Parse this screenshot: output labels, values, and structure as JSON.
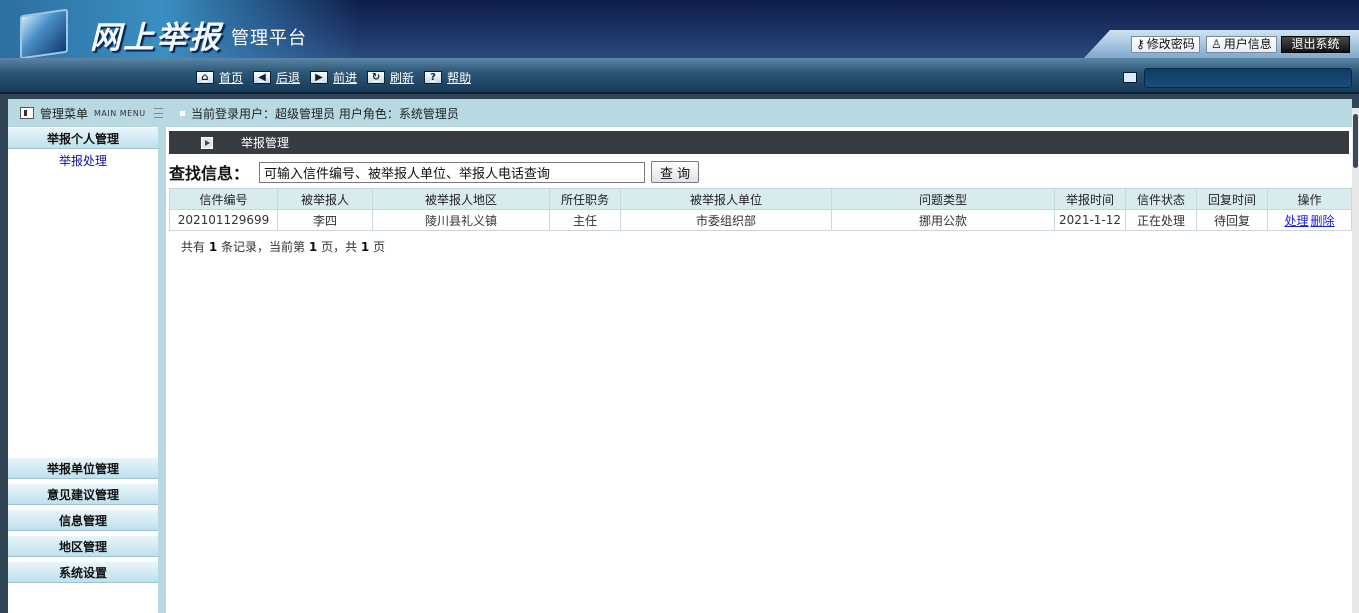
{
  "header": {
    "brand_main": "网上举报",
    "brand_sub": "管理平台",
    "buttons": {
      "change_password": "修改密码",
      "user_info": "用户信息",
      "logout": "退出系统"
    }
  },
  "nav": {
    "items": [
      {
        "label": "首页",
        "icon": "home-icon"
      },
      {
        "label": "后退",
        "icon": "back-arrow-icon"
      },
      {
        "label": "前进",
        "icon": "forward-arrow-icon"
      },
      {
        "label": "刷新",
        "icon": "refresh-icon"
      },
      {
        "label": "帮助",
        "icon": "help-icon"
      }
    ]
  },
  "strip": {
    "menu_title": "管理菜单",
    "menu_sub": "MAIN MENU",
    "user_line": "当前登录用户：超级管理员  用户角色：系统管理员"
  },
  "sidebar": {
    "top_group": "举报个人管理",
    "top_sub": "举报处理",
    "groups": [
      "举报单位管理",
      "意见建议管理",
      "信息管理",
      "地区管理",
      "系统设置"
    ]
  },
  "content": {
    "title": "举报管理",
    "search_label": "查找信息：",
    "search_value": "可输入信件编号、被举报人单位、举报人电话查询",
    "search_button": "查 询",
    "table": {
      "headers": [
        "信件编号",
        "被举报人",
        "被举报人地区",
        "所任职务",
        "被举报人单位",
        "问题类型",
        "举报时间",
        "信件状态",
        "回复时间",
        "操作"
      ],
      "rows": [
        {
          "cells": [
            "202101129699",
            "李四",
            "陵川县礼义镇",
            "主任",
            "市委组织部",
            "挪用公款",
            "2021-1-12",
            "正在处理",
            "待回复"
          ],
          "ops": [
            "处理",
            "删除"
          ]
        }
      ]
    },
    "pager": {
      "prefix": "共有",
      "total": "1",
      "mid1": "条记录，当前第",
      "current": "1",
      "mid2": "页，共",
      "pages": "1",
      "suffix": "页"
    }
  },
  "colors": {
    "header_dark": "#0f1e48",
    "frame": "#314556",
    "strip": "#b8d9e2",
    "table_header": "#d8ecf0",
    "pending_red": "#e02020",
    "link_blue": "#1a1aee"
  }
}
